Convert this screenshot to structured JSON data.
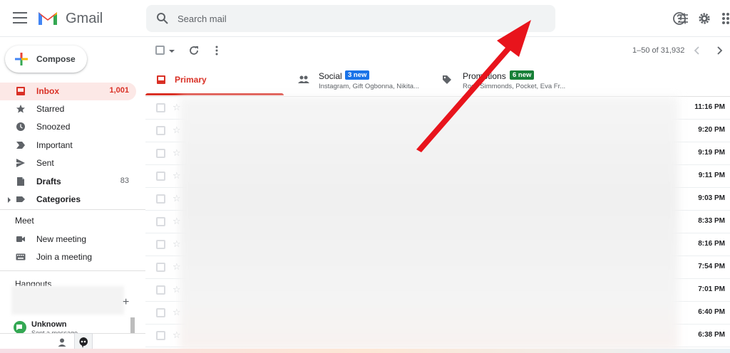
{
  "header": {
    "brand": "Gmail",
    "search_placeholder": "Search mail"
  },
  "sidebar": {
    "compose_label": "Compose",
    "items": [
      {
        "label": "Inbox",
        "count": "1,001",
        "icon": "inbox-icon"
      },
      {
        "label": "Starred",
        "count": "",
        "icon": "star-icon"
      },
      {
        "label": "Snoozed",
        "count": "",
        "icon": "clock-icon"
      },
      {
        "label": "Important",
        "count": "",
        "icon": "label-important-icon"
      },
      {
        "label": "Sent",
        "count": "",
        "icon": "send-icon"
      },
      {
        "label": "Drafts",
        "count": "83",
        "icon": "draft-icon"
      },
      {
        "label": "Categories",
        "count": "",
        "icon": "label-icon"
      }
    ],
    "meet": {
      "title": "Meet",
      "new_meeting": "New meeting",
      "join_meeting": "Join a meeting"
    },
    "hangouts": {
      "title": "Hangouts",
      "contact_name": "Unknown",
      "contact_status": "Sent a message"
    }
  },
  "toolbar": {
    "pager": "1–50 of 31,932"
  },
  "tabs": [
    {
      "label": "Primary",
      "subtitle": "",
      "badge": ""
    },
    {
      "label": "Social",
      "subtitle": "Instagram, Gift Ogbonna, Nikita...",
      "badge": "3 new"
    },
    {
      "label": "Promotions",
      "subtitle": "Ross Simmonds, Pocket, Eva Fr...",
      "badge": "6 new"
    }
  ],
  "emails": [
    {
      "time": "11:16 PM"
    },
    {
      "time": "9:20 PM"
    },
    {
      "time": "9:19 PM"
    },
    {
      "time": "9:11 PM"
    },
    {
      "time": "9:03 PM"
    },
    {
      "time": "8:33 PM"
    },
    {
      "time": "8:16 PM"
    },
    {
      "time": "7:54 PM"
    },
    {
      "time": "7:01 PM"
    },
    {
      "time": "6:40 PM"
    },
    {
      "time": "6:38 PM"
    }
  ],
  "colors": {
    "accent_red": "#d93025",
    "social_badge": "#1a73e8",
    "promos_badge": "#188038",
    "annotation_arrow": "#e8141c"
  }
}
